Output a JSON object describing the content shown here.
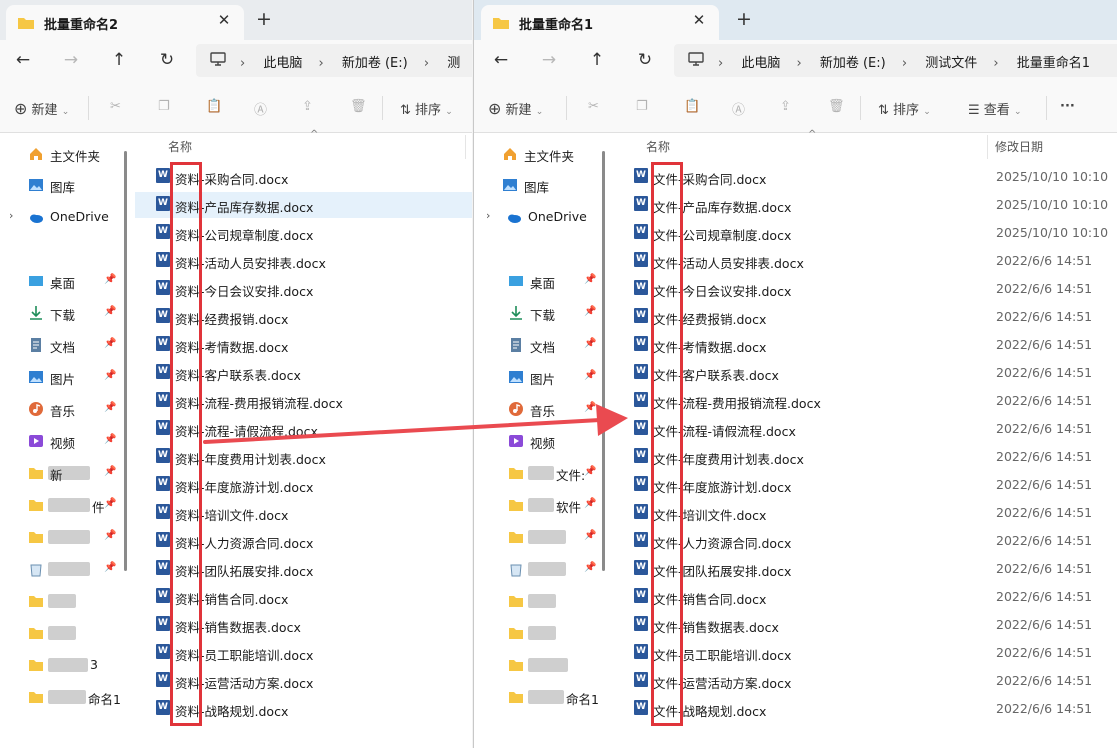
{
  "windows": [
    {
      "title": "批量重命名2",
      "breadcrumbs": [
        "此电脑",
        "新加卷 (E:)",
        "测"
      ],
      "toolbar": {
        "new_label": "新建",
        "sort_label": "排序"
      },
      "column_header": "名称",
      "files": [
        "资料-采购合同.docx",
        "资料-产品库存数据.docx",
        "资料-公司规章制度.docx",
        "资料-活动人员安排表.docx",
        "资料-今日会议安排.docx",
        "资料-经费报销.docx",
        "资料-考情数据.docx",
        "资料-客户联系表.docx",
        "资料-流程-费用报销流程.docx",
        "资料-流程-请假流程.docx",
        "资料-年度费用计划表.docx",
        "资料-年度旅游计划.docx",
        "资料-培训文件.docx",
        "资料-人力资源合同.docx",
        "资料-团队拓展安排.docx",
        "资料-销售合同.docx",
        "资料-销售数据表.docx",
        "资料-员工职能培训.docx",
        "资料-运营活动方案.docx",
        "资料-战略规划.docx"
      ]
    },
    {
      "title": "批量重命名1",
      "breadcrumbs": [
        "此电脑",
        "新加卷 (E:)",
        "测试文件",
        "批量重命名1"
      ],
      "toolbar": {
        "new_label": "新建",
        "sort_label": "排序",
        "view_label": "查看",
        "more_label": "···"
      },
      "column_header": "名称",
      "date_header": "修改日期",
      "files": [
        "文件-采购合同.docx",
        "文件-产品库存数据.docx",
        "文件-公司规章制度.docx",
        "文件-活动人员安排表.docx",
        "文件-今日会议安排.docx",
        "文件-经费报销.docx",
        "文件-考情数据.docx",
        "文件-客户联系表.docx",
        "文件-流程-费用报销流程.docx",
        "文件-流程-请假流程.docx",
        "文件-年度费用计划表.docx",
        "文件-年度旅游计划.docx",
        "文件-培训文件.docx",
        "文件-人力资源合同.docx",
        "文件-团队拓展安排.docx",
        "文件-销售合同.docx",
        "文件-销售数据表.docx",
        "文件-员工职能培训.docx",
        "文件-运营活动方案.docx",
        "文件-战略规划.docx"
      ],
      "dates": [
        "2025/10/10 10:10",
        "2025/10/10 10:10",
        "2025/10/10 10:10",
        "2022/6/6 14:51",
        "2022/6/6 14:51",
        "2022/6/6 14:51",
        "2022/6/6 14:51",
        "2022/6/6 14:51",
        "2022/6/6 14:51",
        "2022/6/6 14:51",
        "2022/6/6 14:51",
        "2022/6/6 14:51",
        "2022/6/6 14:51",
        "2022/6/6 14:51",
        "2022/6/6 14:51",
        "2022/6/6 14:51",
        "2022/6/6 14:51",
        "2022/6/6 14:51",
        "2022/6/6 14:51",
        "2022/6/6 14:51"
      ]
    }
  ],
  "sidebar": {
    "home": "主文件夹",
    "gallery": "图库",
    "onedrive": "OneDrive",
    "desktop": "桌面",
    "downloads": "下载",
    "documents": "文档",
    "pictures": "图片",
    "music": "音乐",
    "videos": "视频",
    "left_partial": [
      "新",
      "件",
      "3",
      "命名1"
    ],
    "right_partial": [
      "文件:",
      "软件",
      "命名1"
    ]
  },
  "colors": {
    "highlight_box": "#e0343a",
    "arrow": "#ea4a50",
    "word_blue": "#2b579a",
    "selected_row": "#e5f1fb"
  }
}
